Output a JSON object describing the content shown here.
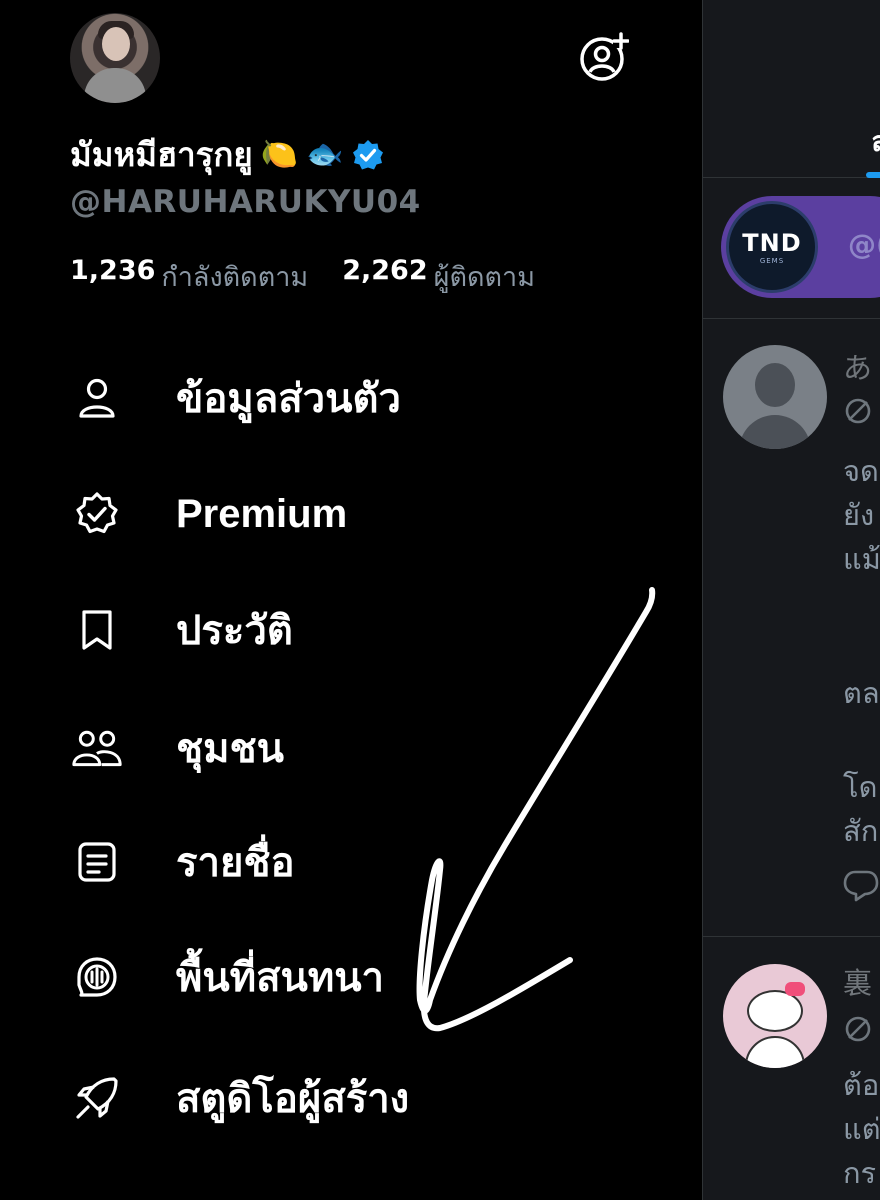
{
  "profile": {
    "display_name": "มัมหมีฮารุกยู",
    "name_emojis": [
      "🍋",
      "🐟"
    ],
    "handle": "@HARUHARUKYU04",
    "following_count": "1,236",
    "following_label": "กำลังติดตาม",
    "followers_count": "2,262",
    "followers_label": "ผู้ติดตาม"
  },
  "menu": {
    "items": [
      {
        "label": "ข้อมูลส่วนตัว",
        "icon": "person-icon"
      },
      {
        "label": "Premium",
        "icon": "verified-badge-icon"
      },
      {
        "label": "ประวัติ",
        "icon": "bookmark-icon"
      },
      {
        "label": "ชุมชน",
        "icon": "people-icon"
      },
      {
        "label": "รายชื่อ",
        "icon": "list-icon"
      },
      {
        "label": "พื้นที่สนทนา",
        "icon": "spaces-icon"
      },
      {
        "label": "สตูดิโอผู้สร้าง",
        "icon": "rocket-icon"
      }
    ]
  },
  "timeline": {
    "tab_fragment": "ล",
    "community_handle": "@(",
    "community_logo_text": "TND",
    "community_logo_subtext": "GEMS",
    "tweet1": {
      "name": "あ",
      "lines": [
        "จด",
        "ยัง",
        "แม้",
        "『",
        "ตล",
        "โด",
        "สัก"
      ]
    },
    "tweet2": {
      "name": "裏",
      "lines": [
        "ต้อ",
        "แต่",
        "กร"
      ]
    }
  },
  "colors": {
    "background": "#000000",
    "verified": "#1d9bf0",
    "community_card": "#5b3fa0",
    "muted_text": "#8b98a5"
  }
}
